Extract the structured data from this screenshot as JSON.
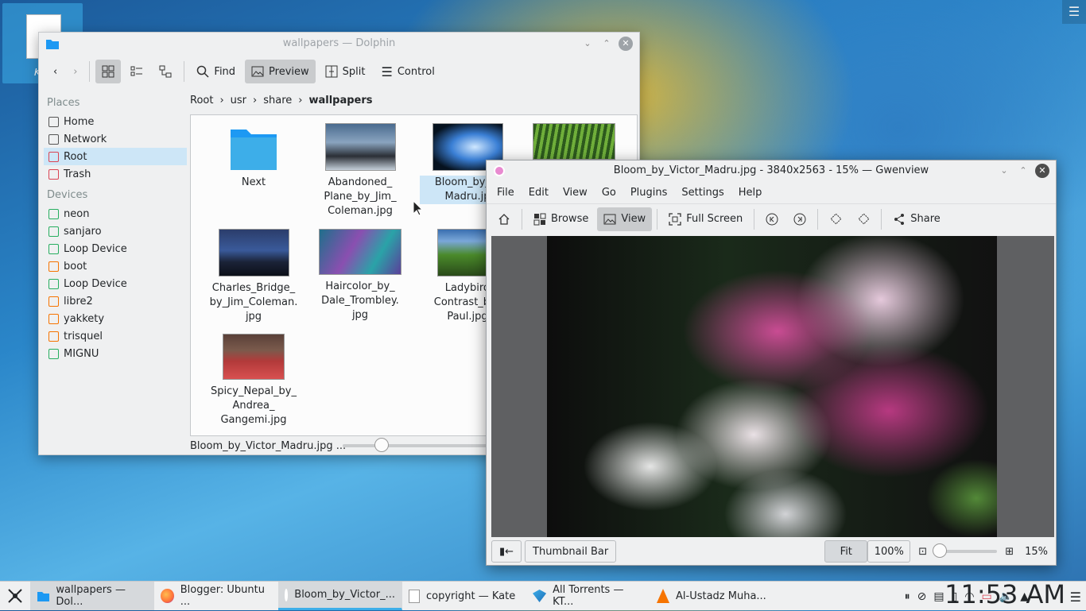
{
  "desktop": {
    "icon_label": "K"
  },
  "dolphin": {
    "title": "wallpapers — Dolphin",
    "toolbar": {
      "find": "Find",
      "preview": "Preview",
      "split": "Split",
      "control": "Control"
    },
    "places_header": "Places",
    "places": [
      "Home",
      "Network",
      "Root",
      "Trash"
    ],
    "devices_header": "Devices",
    "devices": [
      "neon",
      "sanjaro",
      "Loop Device",
      "boot",
      "Loop Device",
      "libre2",
      "yakkety",
      "trisquel",
      "MIGNU"
    ],
    "breadcrumb": [
      "Root",
      "usr",
      "share",
      "wallpapers"
    ],
    "files": [
      {
        "name": "Next"
      },
      {
        "name": "Abandoned_\nPlane_by_Jim_\nColeman.jpg"
      },
      {
        "name": "Bloom_by_Vi\nMadru.jp"
      },
      {
        "name": ""
      },
      {
        "name": "Charles_Bridge_\nby_Jim_Coleman.\njpg"
      },
      {
        "name": "Haircolor_by_\nDale_Trombley.\njpg"
      },
      {
        "name": "Ladybird\nContrast_by_\nPaul.jpg"
      },
      {
        "name": "Spicy_Nepal_by_\nAndrea_\nGangemi.jpg"
      }
    ],
    "status": "Bloom_by_Victor_Madru.jpg ..."
  },
  "gwenview": {
    "title": "Bloom_by_Victor_Madru.jpg - 3840x2563 - 15% — Gwenview",
    "menu": [
      "File",
      "Edit",
      "View",
      "Go",
      "Plugins",
      "Settings",
      "Help"
    ],
    "toolbar": {
      "browse": "Browse",
      "view": "View",
      "fullscreen": "Full Screen",
      "share": "Share"
    },
    "thumbnail_bar": "Thumbnail Bar",
    "fit": "Fit",
    "zoom100": "100%",
    "zoom_level": "15%"
  },
  "taskbar": {
    "tasks": [
      "wallpapers — Dol...",
      "Blogger: Ubuntu ...",
      "Bloom_by_Victor_...",
      "copyright  — Kate",
      "All Torrents — KT...",
      "Al-Ustadz Muha..."
    ],
    "clock": "11:53 AM"
  },
  "colors": {
    "accent": "#3daee9",
    "selection": "#cde6f7",
    "folder": "#1d99f3"
  }
}
